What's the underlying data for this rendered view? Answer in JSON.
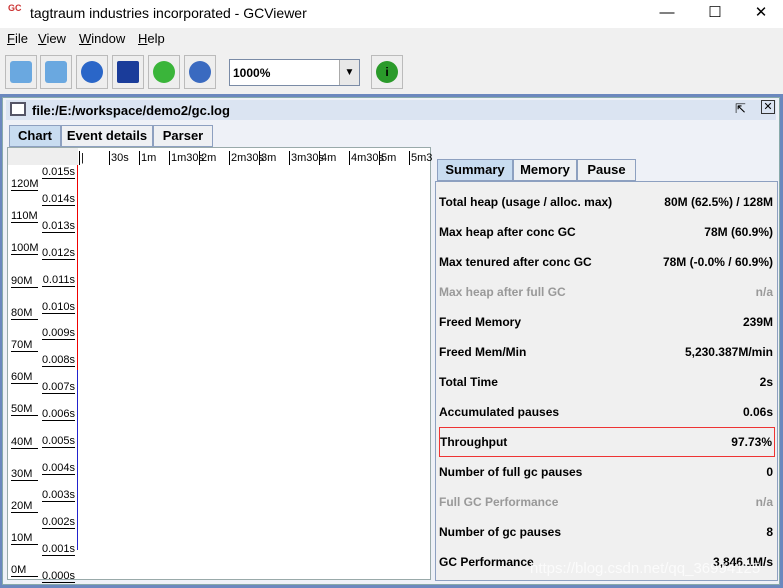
{
  "window": {
    "title": "tagtraum industries incorporated - GCViewer",
    "icon_text": "GC",
    "min": "—",
    "max": "☐",
    "close": "✕"
  },
  "menu": [
    "File",
    "View",
    "Window",
    "Help"
  ],
  "toolbar": {
    "zoom": "1000%",
    "buttons": [
      "open-file",
      "open-recent",
      "open-url",
      "export",
      "refresh",
      "watch",
      "about"
    ]
  },
  "internal_frame": {
    "title": "file:/E:/workspace/demo2/gc.log"
  },
  "tabs": [
    "Chart",
    "Event details",
    "Parser"
  ],
  "chart": {
    "time_ticks": [
      "|",
      "30s",
      "1m",
      "1m30s",
      "2m",
      "2m30s",
      "3m",
      "3m30s",
      "4m",
      "4m30s",
      "5m",
      "5m3"
    ],
    "memory_ticks": [
      "120M",
      "110M",
      "100M",
      "90M",
      "80M",
      "70M",
      "60M",
      "50M",
      "40M",
      "30M",
      "20M",
      "10M",
      "0M"
    ],
    "pause_ticks": [
      "0.015s",
      "0.014s",
      "0.013s",
      "0.012s",
      "0.011s",
      "0.010s",
      "0.009s",
      "0.008s",
      "0.007s",
      "0.006s",
      "0.005s",
      "0.004s",
      "0.003s",
      "0.002s",
      "0.001s",
      "0.000s"
    ]
  },
  "right_tabs": [
    "Summary",
    "Memory",
    "Pause"
  ],
  "summary": [
    {
      "label": "Total heap (usage / alloc. max)",
      "value": "80M (62.5%) / 128M"
    },
    {
      "label": "Max heap after conc GC",
      "value": "78M (60.9%)"
    },
    {
      "label": "Max tenured after conc GC",
      "value": "78M (-0.0% / 60.9%)"
    },
    {
      "label": "Max heap after full GC",
      "value": "n/a",
      "dim": true
    },
    {
      "label": "Freed Memory",
      "value": "239M"
    },
    {
      "label": "Freed Mem/Min",
      "value": "5,230.387M/min"
    },
    {
      "label": "Total Time",
      "value": "2s"
    },
    {
      "label": "Accumulated pauses",
      "value": "0.06s"
    },
    {
      "label": "Throughput",
      "value": "97.73%",
      "highlight": true
    },
    {
      "label": "Number of full gc pauses",
      "value": "0"
    },
    {
      "label": "Full GC Performance",
      "value": "n/a",
      "dim": true
    },
    {
      "label": "Number of gc pauses",
      "value": "8"
    },
    {
      "label": "GC Performance",
      "value": "3,846.1M/s"
    }
  ],
  "watermark": "https://blog.csdn.net/qq_36994125"
}
